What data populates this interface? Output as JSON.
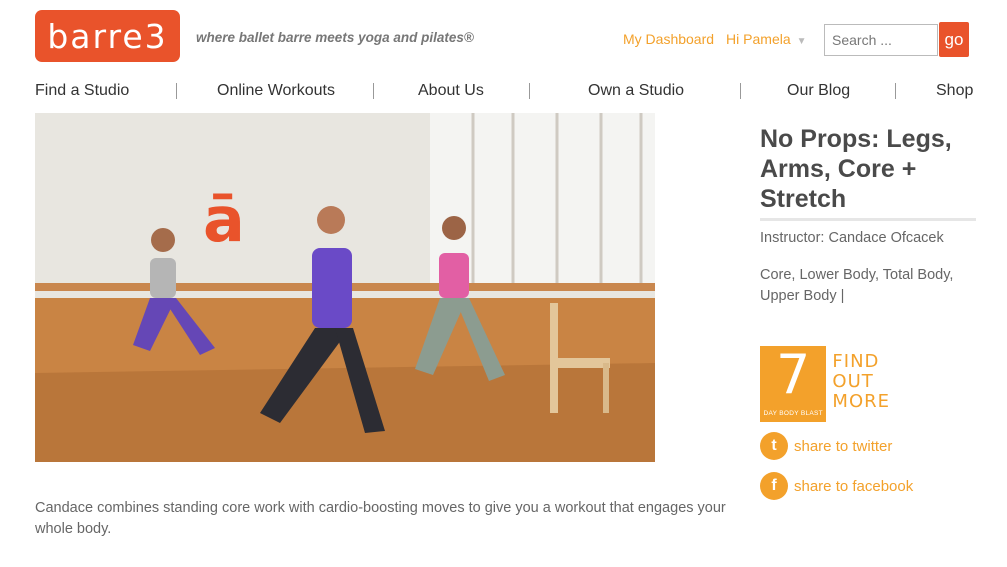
{
  "header": {
    "logo_text": "barre3",
    "tagline": "where ballet barre meets yoga and pilates®",
    "dashboard_link": "My Dashboard",
    "greeting": "Hi Pamela",
    "search_placeholder": "Search ...",
    "go_label": "go"
  },
  "nav": {
    "items": [
      "Find a Studio",
      "Online Workouts",
      "About Us",
      "Own a Studio",
      "Our Blog",
      "Shop"
    ]
  },
  "video": {
    "wall_logo": "ā"
  },
  "workout": {
    "title": "No Props: Legs, Arms, Core + Stretch",
    "instructor": "Instructor: Candace Ofcacek",
    "tags": "Core, Lower Body, Total Body, Upper Body |",
    "description": "Candace combines standing core work with cardio-boosting moves to give you a workout that engages your whole body."
  },
  "promo": {
    "number": "7",
    "subtitle": "DAY BODY BLAST",
    "cta_lines": [
      "FIND",
      "OUT",
      "MORE"
    ]
  },
  "share": {
    "twitter_label": "share to twitter",
    "facebook_label": "share to facebook",
    "twitter_glyph": "t",
    "facebook_glyph": "f"
  },
  "colors": {
    "brand_orange": "#e9532b",
    "accent_yellow": "#f3a12b"
  }
}
